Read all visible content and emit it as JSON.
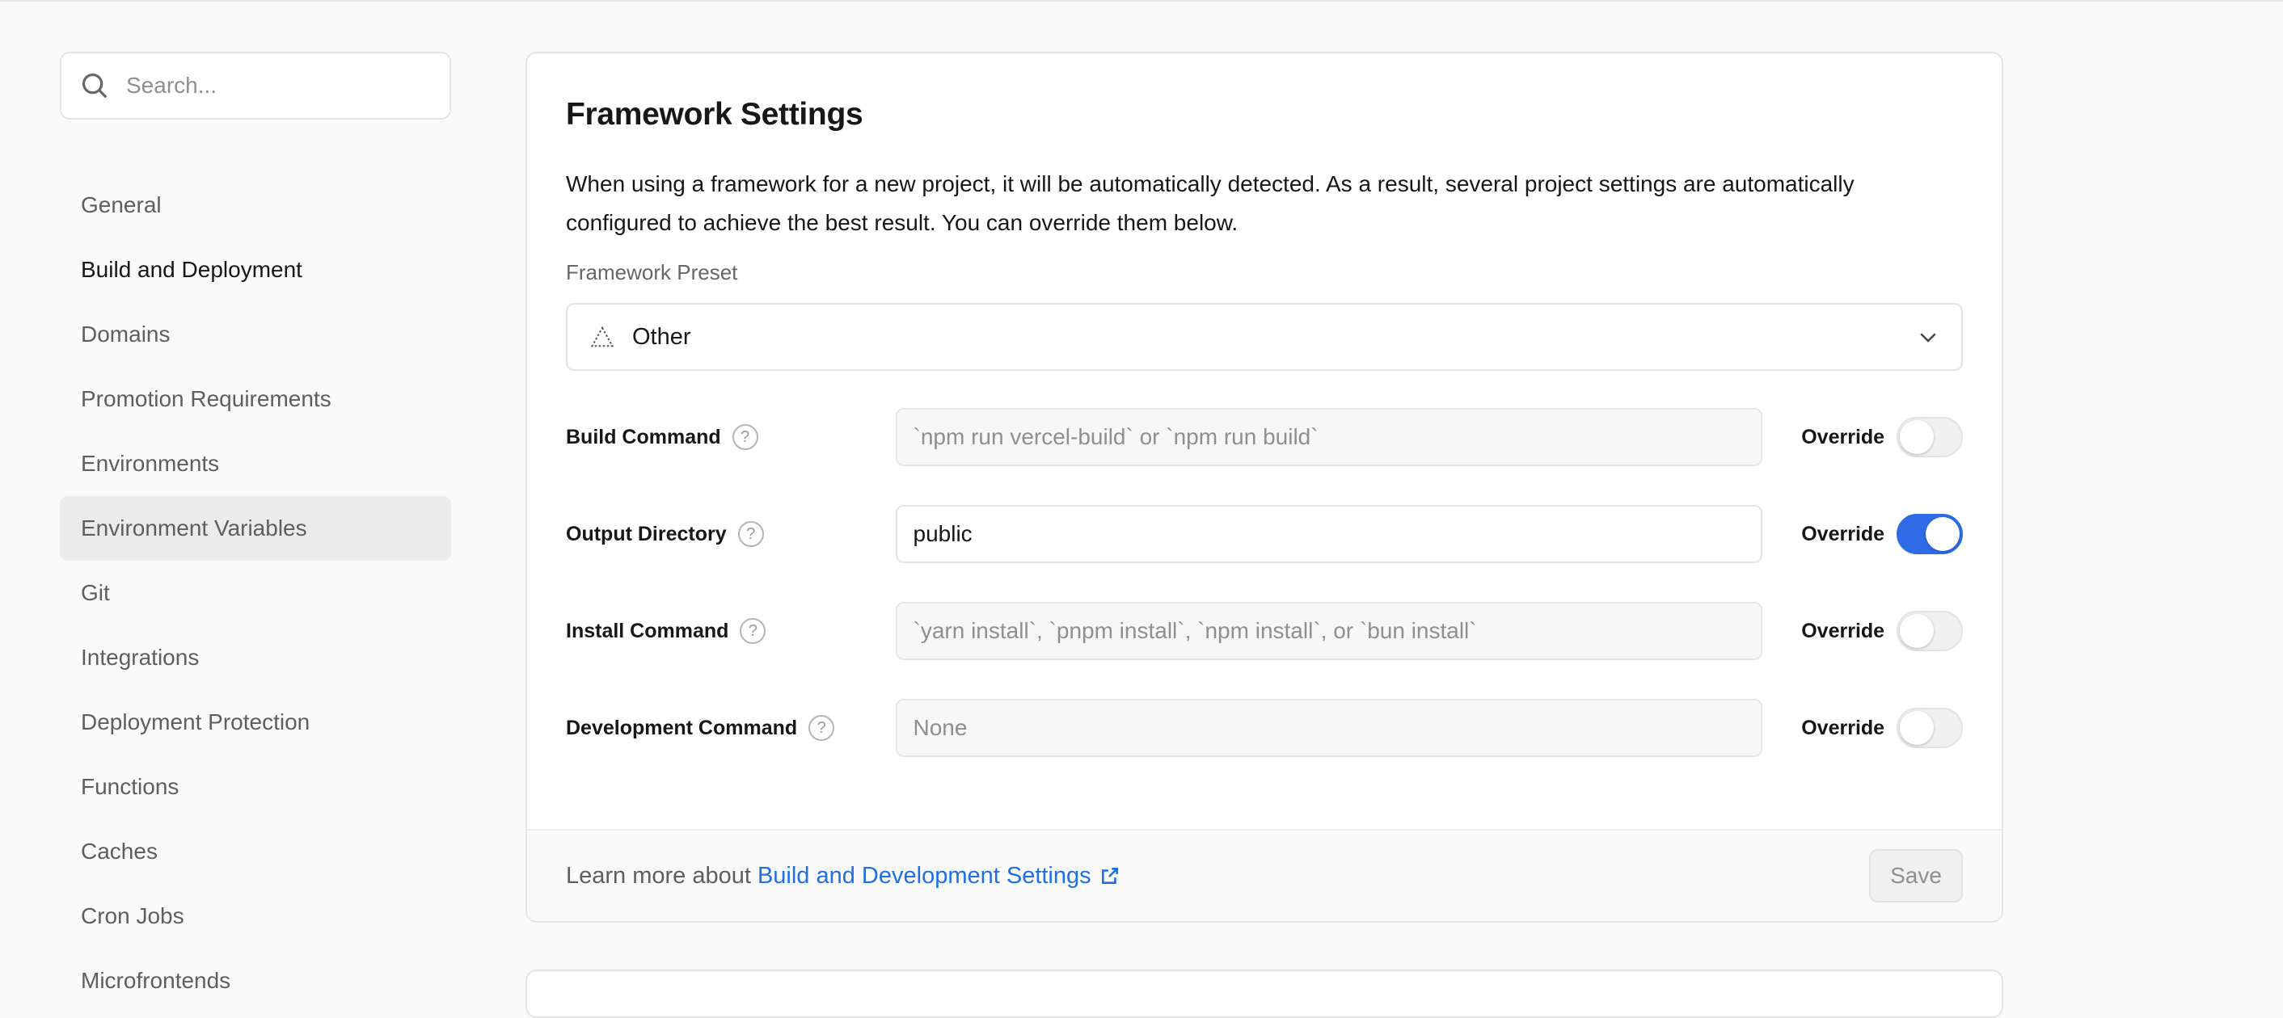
{
  "search": {
    "placeholder": "Search..."
  },
  "sidebar": {
    "items": [
      {
        "label": "General"
      },
      {
        "label": "Build and Deployment"
      },
      {
        "label": "Domains"
      },
      {
        "label": "Promotion Requirements"
      },
      {
        "label": "Environments"
      },
      {
        "label": "Environment Variables"
      },
      {
        "label": "Git"
      },
      {
        "label": "Integrations"
      },
      {
        "label": "Deployment Protection"
      },
      {
        "label": "Functions"
      },
      {
        "label": "Caches"
      },
      {
        "label": "Cron Jobs"
      },
      {
        "label": "Microfrontends"
      }
    ]
  },
  "framework": {
    "title": "Framework Settings",
    "description": "When using a framework for a new project, it will be automatically detected. As a result, several project settings are automatically configured to achieve the best result. You can override them below.",
    "preset_label": "Framework Preset",
    "preset_value": "Other",
    "override_label": "Override",
    "rows": [
      {
        "label": "Build Command",
        "value": "",
        "placeholder": "`npm run vercel-build` or `npm run build`",
        "override": false
      },
      {
        "label": "Output Directory",
        "value": "public",
        "placeholder": "",
        "override": true
      },
      {
        "label": "Install Command",
        "value": "",
        "placeholder": "`yarn install`, `pnpm install`, `npm install`, or `bun install`",
        "override": false
      },
      {
        "label": "Development Command",
        "value": "",
        "placeholder": "None",
        "override": false
      }
    ],
    "footer": {
      "learn_prefix": "Learn more about",
      "learn_link": "Build and Development Settings",
      "save_label": "Save"
    }
  },
  "colors": {
    "accent": "#2f6be6",
    "link": "#1f6fe5"
  }
}
